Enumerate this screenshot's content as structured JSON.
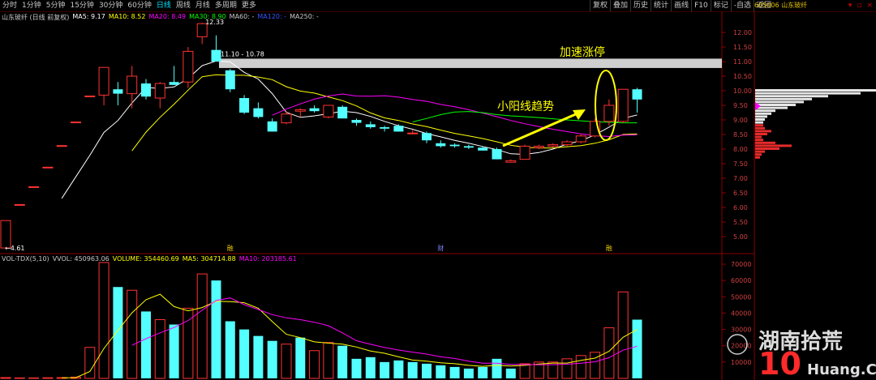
{
  "toolbar": {
    "tabs": [
      "分时",
      "1分钟",
      "5分钟",
      "15分钟",
      "30分钟",
      "60分钟",
      "日线",
      "周线",
      "月线",
      "多周期",
      "更多"
    ],
    "active_tab": "日线",
    "tools": [
      "复权",
      "叠加",
      "历史",
      "统计",
      "画线",
      "F10",
      "标记",
      "-自选",
      "返回"
    ],
    "stock_code": "605006 山东玻纤",
    "window_buttons": [
      "▾",
      "▫",
      "×"
    ]
  },
  "price_legend": {
    "title": "山东玻纤 (日线 前复权)",
    "ma5": "MA5: 9.17",
    "ma10": "MA10: 8.52",
    "ma20": "MA20: 8.49",
    "ma30": "MA30: 8.90",
    "ma60": "MA60: -",
    "ma120": "MA120: -",
    "ma250": "MA250: -"
  },
  "volume_legend": {
    "title": "VOL-TDX(5,10)",
    "vvol": "VVOL: 450963.06",
    "volume": "VOLUME: 354460.69",
    "ma5": "MA5: 304714.88",
    "ma10": "MA10: 203185.61"
  },
  "annotations": {
    "high_label": "12.33",
    "low_label": "4.61",
    "band_label": "11.10 - 10.78",
    "trend_text": "小阳线趋势",
    "limit_text": "加速涨停",
    "markers": [
      "融",
      "财",
      "融"
    ]
  },
  "colors": {
    "up": "#ff3232",
    "down": "#54ffff",
    "ma5": "#ffffff",
    "ma10": "#ffff00",
    "ma20": "#ff00ff",
    "ma30": "#00ff00",
    "annotation": "#ffff00",
    "axis": "#8b0000"
  },
  "watermark": {
    "brand": "湖南拾荒",
    "site": "Huang.CN"
  },
  "chart_data": {
    "type": "candlestick",
    "price_axis": {
      "ylim": [
        4.5,
        12.5
      ],
      "ticks": [
        "12.00",
        "11.50",
        "11.00",
        "10.50",
        "10.00",
        "9.50",
        "9.00",
        "8.50",
        "8.00",
        "7.50",
        "7.00",
        "6.50",
        "6.00",
        "5.50",
        "5.00"
      ]
    },
    "volume_axis": {
      "ylim": [
        0,
        72000
      ],
      "ticks": [
        "70000",
        "60000",
        "50000",
        "40000",
        "30000",
        "20000",
        "10000"
      ]
    },
    "candles": [
      {
        "o": 4.61,
        "h": 5.55,
        "l": 4.61,
        "c": 5.55
      },
      {
        "o": 6.1,
        "h": 6.1,
        "l": 6.1,
        "c": 6.1
      },
      {
        "o": 6.71,
        "h": 6.71,
        "l": 6.71,
        "c": 6.71
      },
      {
        "o": 7.38,
        "h": 7.38,
        "l": 7.38,
        "c": 7.38
      },
      {
        "o": 8.12,
        "h": 8.12,
        "l": 8.12,
        "c": 8.12
      },
      {
        "o": 8.93,
        "h": 8.93,
        "l": 8.93,
        "c": 8.93
      },
      {
        "o": 9.82,
        "h": 9.82,
        "l": 9.82,
        "c": 9.82
      },
      {
        "o": 9.85,
        "h": 10.8,
        "l": 9.5,
        "c": 10.8
      },
      {
        "o": 10.05,
        "h": 10.3,
        "l": 9.5,
        "c": 9.9
      },
      {
        "o": 9.9,
        "h": 10.85,
        "l": 9.4,
        "c": 10.5
      },
      {
        "o": 10.25,
        "h": 10.4,
        "l": 9.7,
        "c": 9.8
      },
      {
        "o": 9.75,
        "h": 10.3,
        "l": 9.4,
        "c": 10.25
      },
      {
        "o": 10.3,
        "h": 10.85,
        "l": 10.2,
        "c": 10.2
      },
      {
        "o": 10.3,
        "h": 11.5,
        "l": 10.1,
        "c": 11.35
      },
      {
        "o": 11.85,
        "h": 12.33,
        "l": 11.6,
        "c": 12.3
      },
      {
        "o": 11.4,
        "h": 11.9,
        "l": 11.0,
        "c": 11.0
      },
      {
        "o": 10.7,
        "h": 10.75,
        "l": 9.95,
        "c": 10.05
      },
      {
        "o": 9.75,
        "h": 9.85,
        "l": 9.2,
        "c": 9.25
      },
      {
        "o": 9.4,
        "h": 9.6,
        "l": 9.05,
        "c": 9.1
      },
      {
        "o": 8.95,
        "h": 9.05,
        "l": 8.6,
        "c": 8.6
      },
      {
        "o": 8.9,
        "h": 9.3,
        "l": 8.85,
        "c": 9.2
      },
      {
        "o": 9.3,
        "h": 9.4,
        "l": 9.1,
        "c": 9.35
      },
      {
        "o": 9.4,
        "h": 9.5,
        "l": 9.25,
        "c": 9.3
      },
      {
        "o": 9.1,
        "h": 9.5,
        "l": 9.05,
        "c": 9.5
      },
      {
        "o": 9.45,
        "h": 9.5,
        "l": 9.1,
        "c": 9.05
      },
      {
        "o": 9.0,
        "h": 9.05,
        "l": 8.8,
        "c": 8.9
      },
      {
        "o": 8.85,
        "h": 8.95,
        "l": 8.7,
        "c": 8.75
      },
      {
        "o": 8.75,
        "h": 8.8,
        "l": 8.6,
        "c": 8.7
      },
      {
        "o": 8.8,
        "h": 8.85,
        "l": 8.6,
        "c": 8.6
      },
      {
        "o": 8.55,
        "h": 8.65,
        "l": 8.5,
        "c": 8.55
      },
      {
        "o": 8.55,
        "h": 8.6,
        "l": 8.2,
        "c": 8.3
      },
      {
        "o": 8.2,
        "h": 8.3,
        "l": 8.05,
        "c": 8.1
      },
      {
        "o": 8.15,
        "h": 8.2,
        "l": 8.05,
        "c": 8.1
      },
      {
        "o": 8.1,
        "h": 8.15,
        "l": 8.0,
        "c": 8.05
      },
      {
        "o": 8.05,
        "h": 8.1,
        "l": 7.95,
        "c": 7.95
      },
      {
        "o": 8.0,
        "h": 8.05,
        "l": 7.65,
        "c": 7.65
      },
      {
        "o": 7.55,
        "h": 7.65,
        "l": 7.55,
        "c": 7.6
      },
      {
        "o": 7.65,
        "h": 8.15,
        "l": 7.65,
        "c": 8.1
      },
      {
        "o": 8.05,
        "h": 8.15,
        "l": 8.0,
        "c": 8.1
      },
      {
        "o": 8.1,
        "h": 8.2,
        "l": 8.05,
        "c": 8.15
      },
      {
        "o": 8.15,
        "h": 8.3,
        "l": 8.1,
        "c": 8.25
      },
      {
        "o": 8.25,
        "h": 8.5,
        "l": 8.2,
        "c": 8.45
      },
      {
        "o": 8.45,
        "h": 9.05,
        "l": 8.4,
        "c": 8.95
      },
      {
        "o": 8.95,
        "h": 9.7,
        "l": 8.8,
        "c": 9.5
      },
      {
        "o": 8.95,
        "h": 10.05,
        "l": 8.9,
        "c": 10.05
      },
      {
        "o": 10.05,
        "h": 10.1,
        "l": 9.25,
        "c": 9.7
      }
    ],
    "volume": [
      {
        "v": 500,
        "up": true
      },
      {
        "v": 300,
        "up": true
      },
      {
        "v": 300,
        "up": true
      },
      {
        "v": 400,
        "up": true
      },
      {
        "v": 500,
        "up": true
      },
      {
        "v": 800,
        "up": true
      },
      {
        "v": 19000,
        "up": true
      },
      {
        "v": 71000,
        "up": true
      },
      {
        "v": 56000,
        "up": false
      },
      {
        "v": 54000,
        "up": true
      },
      {
        "v": 41000,
        "up": false
      },
      {
        "v": 36000,
        "up": true
      },
      {
        "v": 33000,
        "up": false
      },
      {
        "v": 43000,
        "up": true
      },
      {
        "v": 64000,
        "up": true
      },
      {
        "v": 60000,
        "up": false
      },
      {
        "v": 35000,
        "up": false
      },
      {
        "v": 30000,
        "up": false
      },
      {
        "v": 26000,
        "up": false
      },
      {
        "v": 23000,
        "up": false
      },
      {
        "v": 21000,
        "up": true
      },
      {
        "v": 25000,
        "up": false
      },
      {
        "v": 17000,
        "up": true
      },
      {
        "v": 22000,
        "up": true
      },
      {
        "v": 20000,
        "up": false
      },
      {
        "v": 12000,
        "up": false
      },
      {
        "v": 13000,
        "up": false
      },
      {
        "v": 10000,
        "up": false
      },
      {
        "v": 11000,
        "up": false
      },
      {
        "v": 10000,
        "up": false
      },
      {
        "v": 9000,
        "up": false
      },
      {
        "v": 8000,
        "up": false
      },
      {
        "v": 7000,
        "up": false
      },
      {
        "v": 6000,
        "up": false
      },
      {
        "v": 7000,
        "up": false
      },
      {
        "v": 12000,
        "up": false
      },
      {
        "v": 6000,
        "up": false
      },
      {
        "v": 9000,
        "up": true
      },
      {
        "v": 10000,
        "up": true
      },
      {
        "v": 10000,
        "up": true
      },
      {
        "v": 12000,
        "up": true
      },
      {
        "v": 14000,
        "up": true
      },
      {
        "v": 16000,
        "up": true
      },
      {
        "v": 31000,
        "up": true
      },
      {
        "v": 53000,
        "up": true
      },
      {
        "v": 36000,
        "up": false
      }
    ],
    "ma_lines": {
      "ma5": [
        null,
        null,
        null,
        null,
        6.31,
        7.05,
        7.79,
        8.57,
        8.98,
        9.58,
        10.11,
        10.08,
        10.13,
        10.42,
        10.86,
        11.02,
        10.99,
        10.63,
        10.4,
        9.9,
        9.26,
        9.09,
        9.14,
        9.21,
        9.3,
        9.25,
        9.12,
        8.95,
        8.8,
        8.68,
        8.53,
        8.42,
        8.3,
        8.2,
        8.09,
        7.98,
        7.84,
        7.82,
        7.88,
        8.0,
        8.17,
        8.29,
        8.49,
        8.75,
        9.05,
        9.17
      ],
      "ma10": [
        null,
        null,
        null,
        null,
        null,
        null,
        null,
        null,
        null,
        7.94,
        8.58,
        9.09,
        9.54,
        10.02,
        10.48,
        10.55,
        10.53,
        10.53,
        10.47,
        10.38,
        10.14,
        9.99,
        9.92,
        9.79,
        9.66,
        9.48,
        9.24,
        9.07,
        8.98,
        8.86,
        8.77,
        8.65,
        8.54,
        8.45,
        8.36,
        8.25,
        8.13,
        8.06,
        8.04,
        8.04,
        8.08,
        8.12,
        8.2,
        8.32,
        8.5,
        8.52
      ],
      "ma20": [
        null,
        null,
        null,
        null,
        null,
        null,
        null,
        null,
        null,
        null,
        null,
        null,
        null,
        null,
        null,
        null,
        null,
        null,
        null,
        9.16,
        9.37,
        9.55,
        9.71,
        9.82,
        9.89,
        9.82,
        9.81,
        9.83,
        9.78,
        9.7,
        9.64,
        9.53,
        9.45,
        9.35,
        9.23,
        9.11,
        8.98,
        8.87,
        8.77,
        8.68,
        8.6,
        8.52,
        8.46,
        8.43,
        8.48,
        8.49
      ],
      "ma30": [
        null,
        null,
        null,
        null,
        null,
        null,
        null,
        null,
        null,
        null,
        null,
        null,
        null,
        null,
        null,
        null,
        null,
        null,
        null,
        null,
        null,
        null,
        null,
        null,
        null,
        null,
        null,
        null,
        null,
        8.93,
        9.05,
        9.18,
        9.27,
        9.29,
        9.25,
        9.18,
        9.14,
        9.11,
        9.08,
        9.04,
        9.0,
        8.97,
        8.94,
        8.92,
        8.9,
        8.9
      ]
    }
  }
}
